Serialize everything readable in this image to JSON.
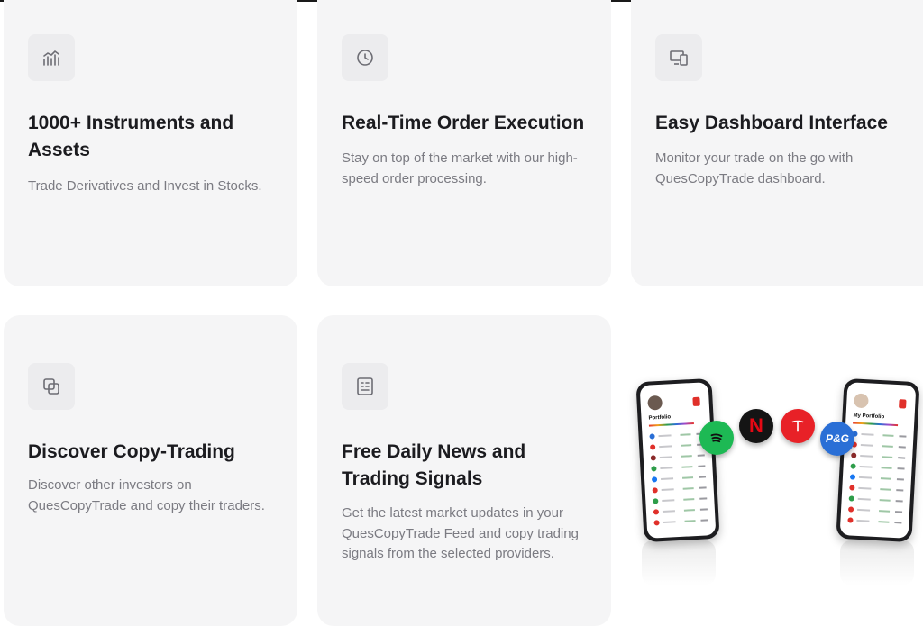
{
  "cards": [
    {
      "icon": "chart-line-icon",
      "title": "1000+ Instruments and Assets",
      "description": "Trade Derivatives and Invest in Stocks."
    },
    {
      "icon": "clock-icon",
      "title": "Real-Time Order Execution",
      "description": "Stay on top of the market with our high-speed order processing."
    },
    {
      "icon": "devices-icon",
      "title": "Easy Dashboard Interface",
      "description": "Monitor your trade on the go with QuesCopyTrade dashboard."
    },
    {
      "icon": "copy-icon",
      "title": "Discover Copy-Trading",
      "description": "Discover other investors on QuesCopyTrade and copy their traders."
    },
    {
      "icon": "news-icon",
      "title": "Free Daily News and Trading Signals",
      "description": "Get the latest market updates in your QuesCopyTrade Feed and copy trading signals from the selected providers."
    }
  ],
  "promo": {
    "left_phone_title": "Portfolio",
    "right_phone_title": "My Portfolio",
    "brand_badges": [
      {
        "name": "spotify-logo",
        "color": "#1db954"
      },
      {
        "name": "netflix-logo",
        "color": "#e50914"
      },
      {
        "name": "tesla-logo",
        "color": "#e82127"
      },
      {
        "name": "pg-logo",
        "text": "P&G",
        "color": "#2a6fd6"
      }
    ]
  },
  "colors": {
    "card_bg": "#f5f5f6",
    "icon_bg": "#ececee",
    "title": "#1b1b1f",
    "description": "#7b7b82"
  }
}
